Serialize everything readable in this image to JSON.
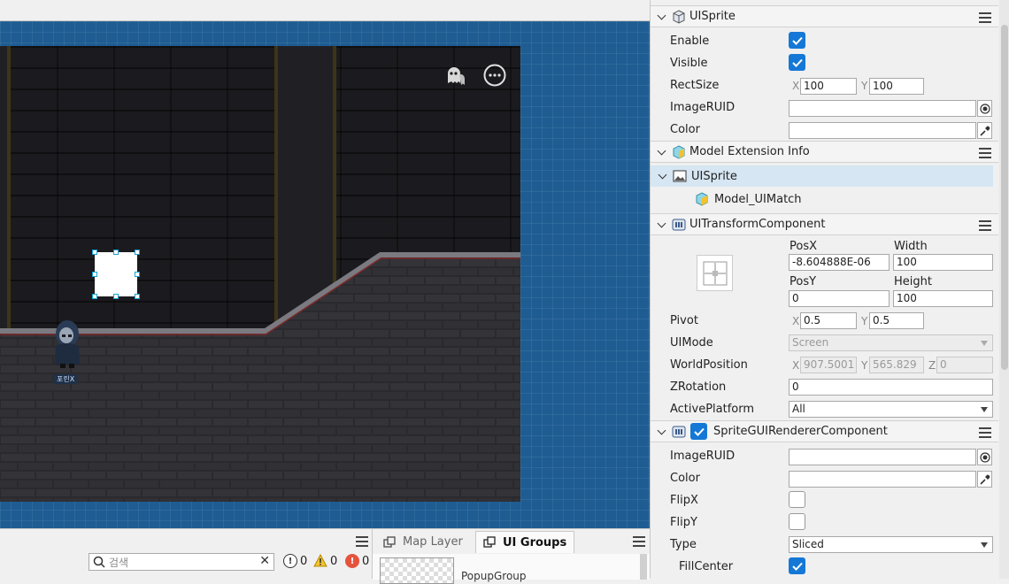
{
  "scene": {
    "character_nametag": "포린X"
  },
  "bottom_left": {
    "search_placeholder": "검색",
    "error_count": "0",
    "warning_count": "0",
    "info_count": "0"
  },
  "bottom_right": {
    "tabs": [
      {
        "label": "Map Layer"
      },
      {
        "label": "UI Groups"
      }
    ],
    "group_item": "PopupGroup"
  },
  "inspector": {
    "uisprite_section": {
      "title": "UISprite",
      "enable_label": "Enable",
      "visible_label": "Visible",
      "rectsize_label": "RectSize",
      "rectsize_x": "100",
      "rectsize_y": "100",
      "imageruid_label": "ImageRUID",
      "color_label": "Color"
    },
    "model_section": {
      "title": "Model Extension Info",
      "tree_root": "UISprite",
      "tree_child": "Model_UIMatch"
    },
    "transform_section": {
      "title": "UITransformComponent",
      "posx_label": "PosX",
      "posx": "-8.604888E-06",
      "width_label": "Width",
      "width": "100",
      "posy_label": "PosY",
      "posy": "0",
      "height_label": "Height",
      "height": "100",
      "pivot_label": "Pivot",
      "pivot_x": "0.5",
      "pivot_y": "0.5",
      "uimode_label": "UIMode",
      "uimode": "Screen",
      "worldpos_label": "WorldPosition",
      "world_x": "907.5001",
      "world_y": "565.829",
      "world_z": "0",
      "zrotation_label": "ZRotation",
      "zrotation": "0",
      "activeplatform_label": "ActivePlatform",
      "activeplatform": "All"
    },
    "renderer_section": {
      "title": "SpriteGUIRendererComponent",
      "imageruid_label": "ImageRUID",
      "color_label": "Color",
      "flipx_label": "FlipX",
      "flipy_label": "FlipY",
      "type_label": "Type",
      "type": "Sliced",
      "fillcenter_label": "FillCenter"
    },
    "axis": {
      "x": "X",
      "y": "Y",
      "z": "Z"
    }
  }
}
